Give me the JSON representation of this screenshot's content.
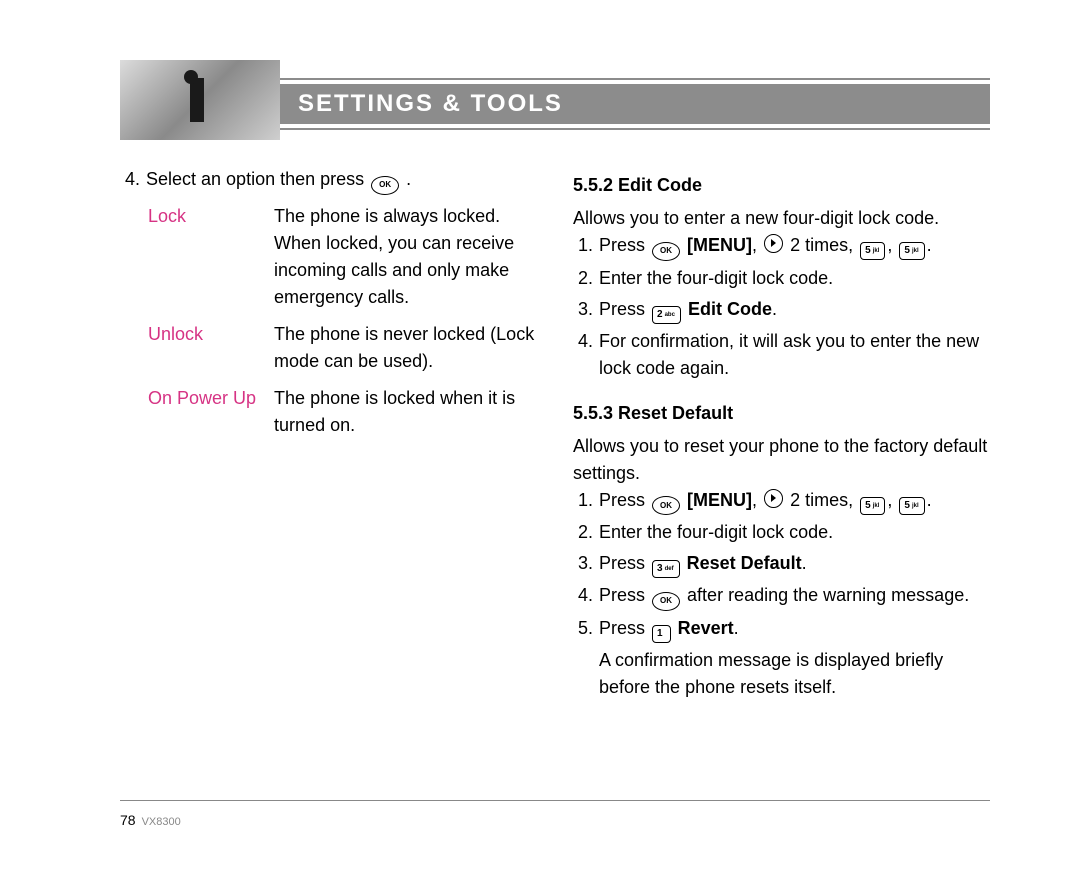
{
  "header": {
    "title": "SETTINGS & TOOLS"
  },
  "left": {
    "line4_pre": "Select an option then press",
    "options": [
      {
        "name": "Lock",
        "desc": "The phone is always locked. When locked, you can receive incoming calls and only make emergency calls."
      },
      {
        "name": "Unlock",
        "desc": "The phone is never locked (Lock mode can be used)."
      },
      {
        "name": "On Power Up",
        "desc": "The phone is locked when it is turned on."
      }
    ]
  },
  "right": {
    "sec552_heading": "5.5.2 Edit Code",
    "sec552_intro": "Allows you to enter a new four-digit lock code.",
    "sec552_s1_press": "Press",
    "sec552_s1_menu": "[MENU]",
    "sec552_s1_times": "2 times,",
    "sec552_s2": "Enter the four-digit lock code.",
    "sec552_s3_press": "Press",
    "sec552_s3_label": "Edit Code",
    "sec552_s4": "For confirmation, it will ask you to enter the new lock code again.",
    "sec553_heading": "5.5.3 Reset Default",
    "sec553_intro": "Allows you to reset your phone to the factory default settings.",
    "sec553_s1_press": "Press",
    "sec553_s1_menu": "[MENU]",
    "sec553_s1_times": "2 times,",
    "sec553_s2": "Enter the four-digit lock code.",
    "sec553_s3_press": "Press",
    "sec553_s3_label": "Reset Default",
    "sec553_s4_press": "Press",
    "sec553_s4_rest": "after reading the warning message.",
    "sec553_s5_press": "Press",
    "sec553_s5_label": "Revert",
    "sec553_s5_tail": "A confirmation message is displayed briefly before the phone resets itself."
  },
  "keys": {
    "ok": "OK",
    "one": "1",
    "one_sub": "",
    "two": "2",
    "two_sub": "abc",
    "three": "3",
    "three_sub": "def",
    "five": "5",
    "five_sub": "jkl"
  },
  "footer": {
    "page": "78",
    "model": "VX8300"
  }
}
